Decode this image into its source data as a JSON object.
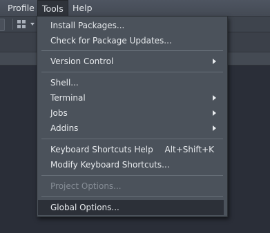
{
  "menubar": {
    "items": [
      {
        "label": "Profile"
      },
      {
        "label": "Tools"
      },
      {
        "label": "Help"
      }
    ]
  },
  "toolbar": {
    "icons": [
      "grid-icon",
      "chevron-down-icon"
    ]
  },
  "tools_menu": {
    "groups": [
      [
        {
          "label": "Install Packages...",
          "shortcut": "",
          "submenu": false,
          "disabled": false
        },
        {
          "label": "Check for Package Updates...",
          "shortcut": "",
          "submenu": false,
          "disabled": false
        }
      ],
      [
        {
          "label": "Version Control",
          "shortcut": "",
          "submenu": true,
          "disabled": false
        }
      ],
      [
        {
          "label": "Shell...",
          "shortcut": "",
          "submenu": false,
          "disabled": false
        },
        {
          "label": "Terminal",
          "shortcut": "",
          "submenu": true,
          "disabled": false
        },
        {
          "label": "Jobs",
          "shortcut": "",
          "submenu": true,
          "disabled": false
        },
        {
          "label": "Addins",
          "shortcut": "",
          "submenu": true,
          "disabled": false
        }
      ],
      [
        {
          "label": "Keyboard Shortcuts Help",
          "shortcut": "Alt+Shift+K",
          "submenu": false,
          "disabled": false
        },
        {
          "label": "Modify Keyboard Shortcuts...",
          "shortcut": "",
          "submenu": false,
          "disabled": false
        }
      ],
      [
        {
          "label": "Project Options...",
          "shortcut": "",
          "submenu": false,
          "disabled": true
        }
      ],
      [
        {
          "label": "Global Options...",
          "shortcut": "",
          "submenu": false,
          "disabled": false,
          "highlighted": true
        }
      ]
    ]
  },
  "colors": {
    "menu_bg": "#4b525b",
    "highlight_bg": "#2c3038",
    "text": "#e8ebee",
    "disabled_text": "#868d96"
  }
}
